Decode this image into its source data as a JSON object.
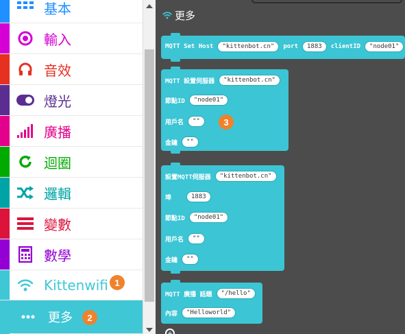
{
  "toolbox": {
    "categories": [
      {
        "label": "基本",
        "color": "#1e90ff",
        "icon": "grid-icon"
      },
      {
        "label": "輸入",
        "color": "#d400d4",
        "icon": "radio-target-icon"
      },
      {
        "label": "音效",
        "color": "#e63022",
        "icon": "headphones-icon"
      },
      {
        "label": "燈光",
        "color": "#5c2d91",
        "icon": "toggle-icon"
      },
      {
        "label": "廣播",
        "color": "#e3008c",
        "icon": "signal-bars-icon"
      },
      {
        "label": "迴圈",
        "color": "#00aa00",
        "icon": "refresh-icon"
      },
      {
        "label": "邏輯",
        "color": "#00a4a6",
        "icon": "shuffle-icon"
      },
      {
        "label": "變數",
        "color": "#dc143c",
        "icon": "list-icon"
      },
      {
        "label": "數學",
        "color": "#9400d3",
        "icon": "calculator-icon"
      },
      {
        "label": "Kittenwifi",
        "color": "#3fc7d6",
        "icon": "wifi-icon"
      },
      {
        "label": "更多",
        "color": "#3fc7d6",
        "icon": "more-dots-icon"
      }
    ],
    "badges": [
      "1",
      "2",
      "3"
    ]
  },
  "flyout": {
    "title": "更多",
    "blocks": {
      "set_host": {
        "label1": "MQTT Set Host",
        "host": "kittenbot.cn",
        "label2": "port",
        "port": "1883",
        "label3": "clientID",
        "client": "node01"
      },
      "server_a": {
        "label": "MQTT 設置伺服器",
        "host": "kittenbot.cn",
        "node_label": "節點ID",
        "node": "node01",
        "user_label": "用戶名",
        "user": "",
        "pass_label": "金鑰",
        "pass": ""
      },
      "server_b": {
        "label": "設置MQTT伺服器",
        "host": "kittenbot.cn",
        "port_label": "埠",
        "port": "1883",
        "node_label": "節點ID",
        "node": "node01",
        "user_label": "用戶名",
        "user": "",
        "pass_label": "金鑰",
        "pass": ""
      },
      "publish": {
        "label": "MQTT 廣播 話題",
        "topic": "/hello",
        "content_label": "內容",
        "content": "Helloworld"
      }
    }
  }
}
